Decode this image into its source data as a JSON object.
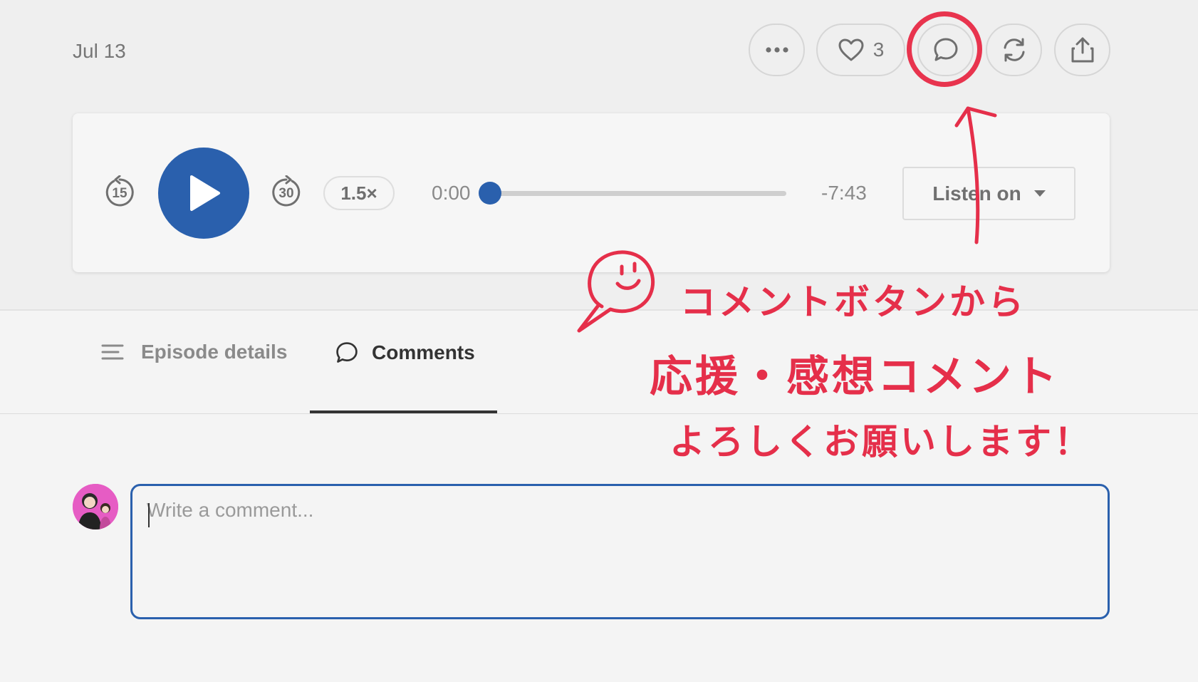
{
  "header": {
    "date": "Jul 13",
    "like_count": "3"
  },
  "icons": {
    "more": "more-dots-icon",
    "like": "heart-icon",
    "comment": "comment-icon",
    "restack": "restack-icon",
    "share": "share-icon"
  },
  "player": {
    "skip_back": "15",
    "skip_forward": "30",
    "speed": "1.5×",
    "current_time": "0:00",
    "remaining_time": "-7:43",
    "progress": 0,
    "listen_on": "Listen on"
  },
  "tabs": [
    {
      "label": "Episode details",
      "active": false
    },
    {
      "label": "Comments",
      "active": true
    }
  ],
  "comment": {
    "placeholder": "Write a comment..."
  },
  "annotation": {
    "line1": "コメントボタンから",
    "line2": "応援・感想コメント",
    "line3": "よろしくお願いします！"
  },
  "colors": {
    "accent": "#2a60ad",
    "annotation": "#e52f4a",
    "avatar_bg": "#e65cc4"
  }
}
